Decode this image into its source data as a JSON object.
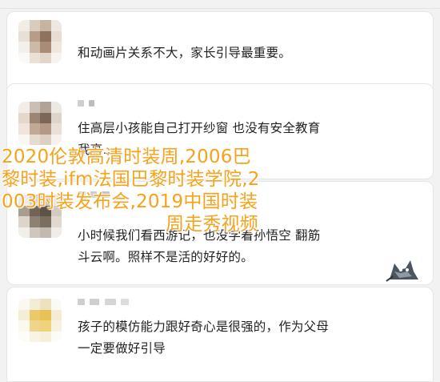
{
  "comments": [
    {
      "text": "和动画片关系不大，家长引导最重要。",
      "avatar_colors": [
        "#f1ece6",
        "#d9cbbd",
        "#c8b2a0",
        "#efe8e1",
        "#e8dfd7",
        "#b79c88",
        "#8e725f",
        "#e7ddd3",
        "#f3efea",
        "#cdb9a8",
        "#a88c77",
        "#efe6de",
        "#fbf9f7",
        "#eae0d6",
        "#e2d6ca",
        "#f7f3ef"
      ]
    },
    {
      "text": "住高层小孩能自己打开纱窗 也没有安全教育",
      "line2": "我高…",
      "avatar_colors": [
        "#f2ede8",
        "#cbbfb5",
        "#b3a396",
        "#eee8e2",
        "#e5d8ca",
        "#9d8575",
        "#7c6658",
        "#dfd4c9",
        "#efe5dc",
        "#c2a996",
        "#b49a86",
        "#e9e0d7",
        "#faf6f2",
        "#e6dbd0",
        "#ddd0c3",
        "#f6f1ec"
      ]
    },
    {
      "text": "小时候我们看西游记，也没学着孙悟空 翻筋",
      "line2": "斗云啊。照样不是活的好好的。",
      "avatar_colors": [
        "#efebe6",
        "#d6d0c8",
        "#c9c1b6",
        "#eae6e1",
        "#a99d8f",
        "#6f6456",
        "#5c5246",
        "#d4cbc0",
        "#ddd4ca",
        "#8d8173",
        "#7a6e60",
        "#e1d9d0",
        "#f2eee9",
        "#cfc7bd",
        "#c3baaf",
        "#f0ece7"
      ]
    },
    {
      "text": "孩子的模仿能力跟好奇心是很强的，作为父母",
      "line2": "一定要做好引导",
      "avatar_colors": [
        "#fbf8f0",
        "#f3edd8",
        "#ece2c0",
        "#fbf9f3",
        "#f5eed6",
        "#e9c96a",
        "#e7c257",
        "#f4edd3",
        "#fbf8ee",
        "#efd58c",
        "#f0d27a",
        "#f7f1de",
        "#fdfcf8",
        "#f8f3e4",
        "#f6efda",
        "#fdfbf6"
      ]
    }
  ],
  "overlay": {
    "line1": "2020伦敦高清时装周,2006巴",
    "line2": "黎时装,ifm法国巴黎时装学院,2",
    "line3": "003时装发布会,2019中国时装",
    "line4": "周走秀视频"
  },
  "colors": {
    "overlay_text": "#f7a21b",
    "comment_text": "#222222",
    "background": "#f2f2f2"
  }
}
